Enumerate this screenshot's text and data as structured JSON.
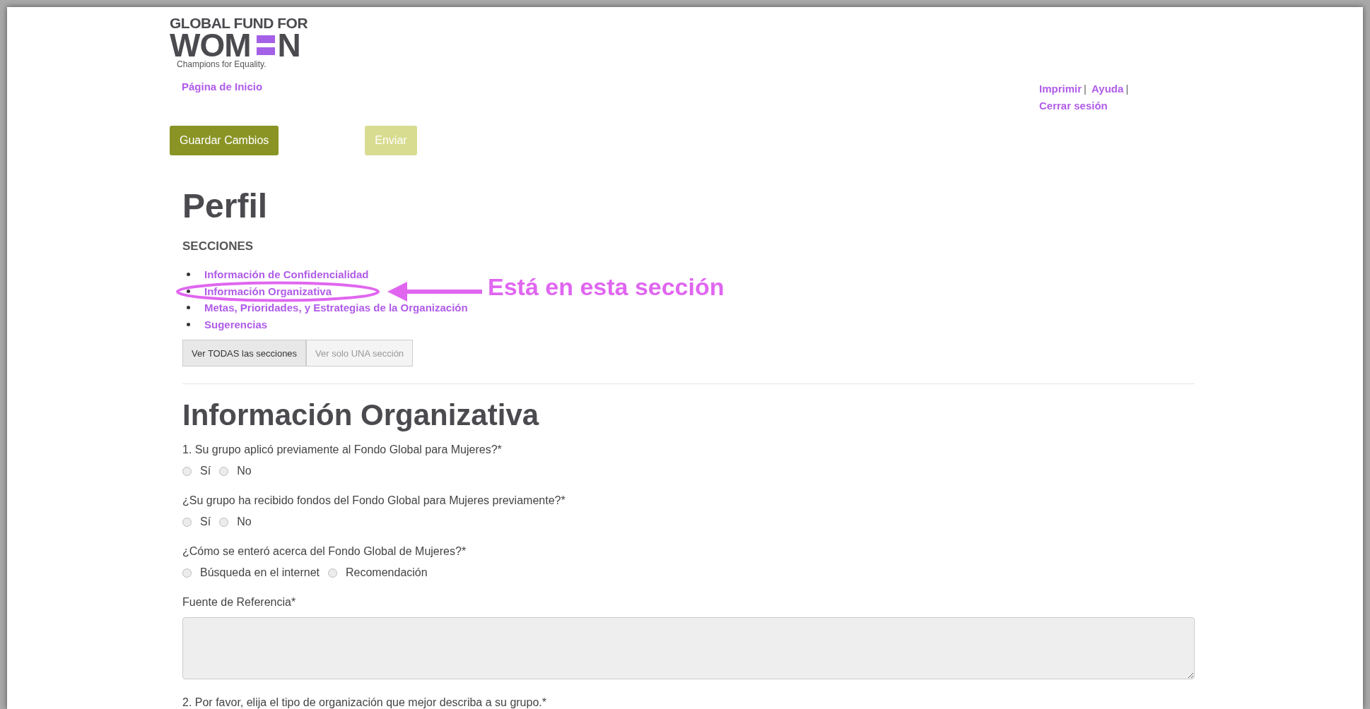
{
  "logo": {
    "line_1": "GLOBAL FUND FOR",
    "line_2_start": "WOM",
    "line_2_end": "N",
    "tagline": "Champions for Equality."
  },
  "home_link": "Página de Inicio",
  "utility_links": {
    "separator": "|",
    "items": [
      "Imprimir",
      "Ayuda",
      "Cerrar sesión"
    ]
  },
  "buttons": [
    {
      "label": "Guardar Cambios",
      "disabled": false
    },
    {
      "label": "Enviar",
      "disabled": true
    }
  ],
  "page_title": "Perfil",
  "sections_heading": "SECCIONES",
  "sections": [
    {
      "label": "Información de Confidencialidad",
      "highlighted": false
    },
    {
      "label": "Información Organizativa",
      "highlighted": true
    },
    {
      "label": "Metas, Prioridades, y Estrategias de la Organización",
      "highlighted": false
    },
    {
      "label": "Sugerencias",
      "highlighted": false
    }
  ],
  "annotation": "Está en esta sección",
  "view_toggle": [
    {
      "label": "Ver TODAS las secciones",
      "selected": true
    },
    {
      "label": "Ver solo UNA sección",
      "selected": false
    }
  ],
  "form": {
    "heading": "Información Organizativa",
    "questions": [
      {
        "kind": "radio",
        "label": "1. Su grupo aplicó previamente al Fondo Global para Mujeres?*",
        "options": [
          {
            "label": "Sí",
            "selected": false
          },
          {
            "label": "No",
            "selected": false
          }
        ]
      },
      {
        "kind": "radio",
        "label": "¿Su grupo ha recibido fondos del Fondo Global para Mujeres previamente?*",
        "options": [
          {
            "label": "Sí",
            "selected": false
          },
          {
            "label": "No",
            "selected": false
          }
        ]
      },
      {
        "kind": "radio",
        "label": "¿Cómo se enteró acerca del Fondo Global de Mujeres?*",
        "options": [
          {
            "label": "Búsqueda en el internet",
            "selected": false
          },
          {
            "label": "Recomendación",
            "selected": false
          }
        ]
      },
      {
        "kind": "textarea",
        "label": "Fuente de Referencia*"
      },
      {
        "kind": "radio",
        "label": "2. Por favor, elija el tipo de organización que mejor describa a su grupo.*"
      }
    ]
  }
}
